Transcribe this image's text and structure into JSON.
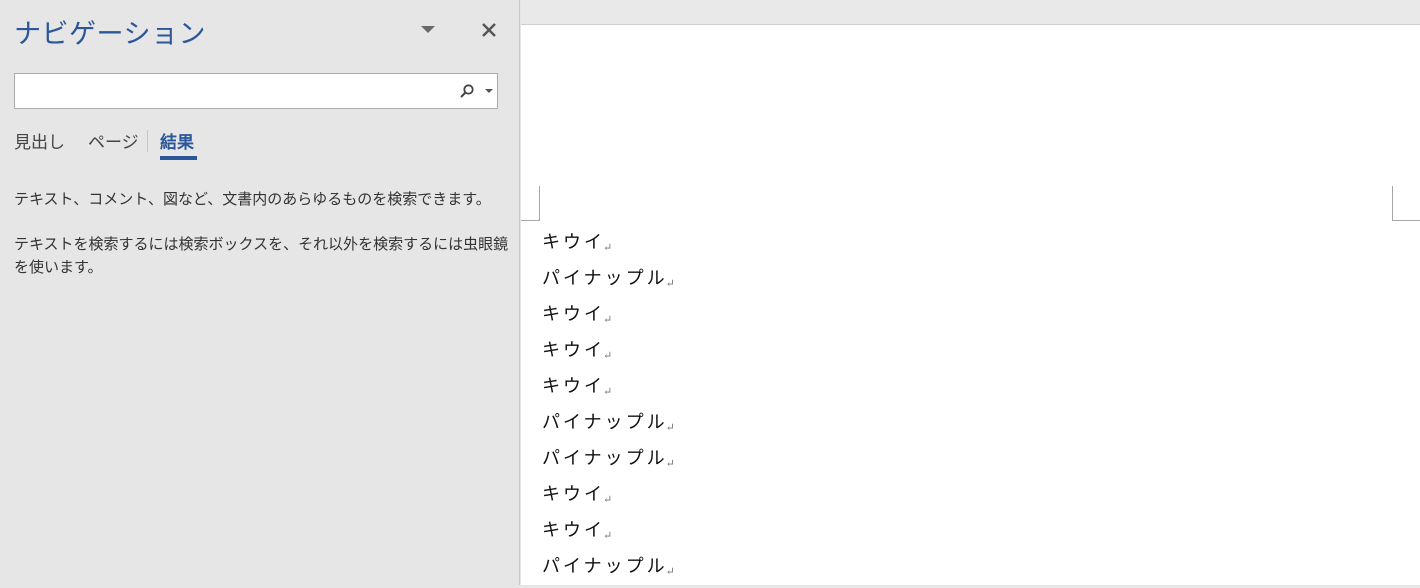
{
  "navigation": {
    "title": "ナビゲーション",
    "search": {
      "value": "",
      "placeholder": ""
    },
    "tabs": [
      {
        "label": "見出し",
        "active": false
      },
      {
        "label": "ページ",
        "active": false
      },
      {
        "label": "結果",
        "active": true
      }
    ],
    "messages": [
      "テキスト、コメント、図など、文書内のあらゆるものを検索できます。",
      "テキストを検索するには検索ボックスを、それ以外を検索するには虫眼鏡を使います。"
    ]
  },
  "document": {
    "paragraph_mark": "↵",
    "lines": [
      "キウイ",
      "パイナップル",
      "キウイ",
      "キウイ",
      "キウイ",
      "パイナップル",
      "パイナップル",
      "キウイ",
      "キウイ",
      "パイナップル"
    ]
  },
  "colors": {
    "accent": "#2b579a",
    "pane_background": "#e6e6e6",
    "document_background": "#ffffff"
  },
  "icons": {
    "options": "chevron-down-icon",
    "close": "close-icon",
    "search": "search-icon",
    "search_options": "caret-down-icon"
  }
}
